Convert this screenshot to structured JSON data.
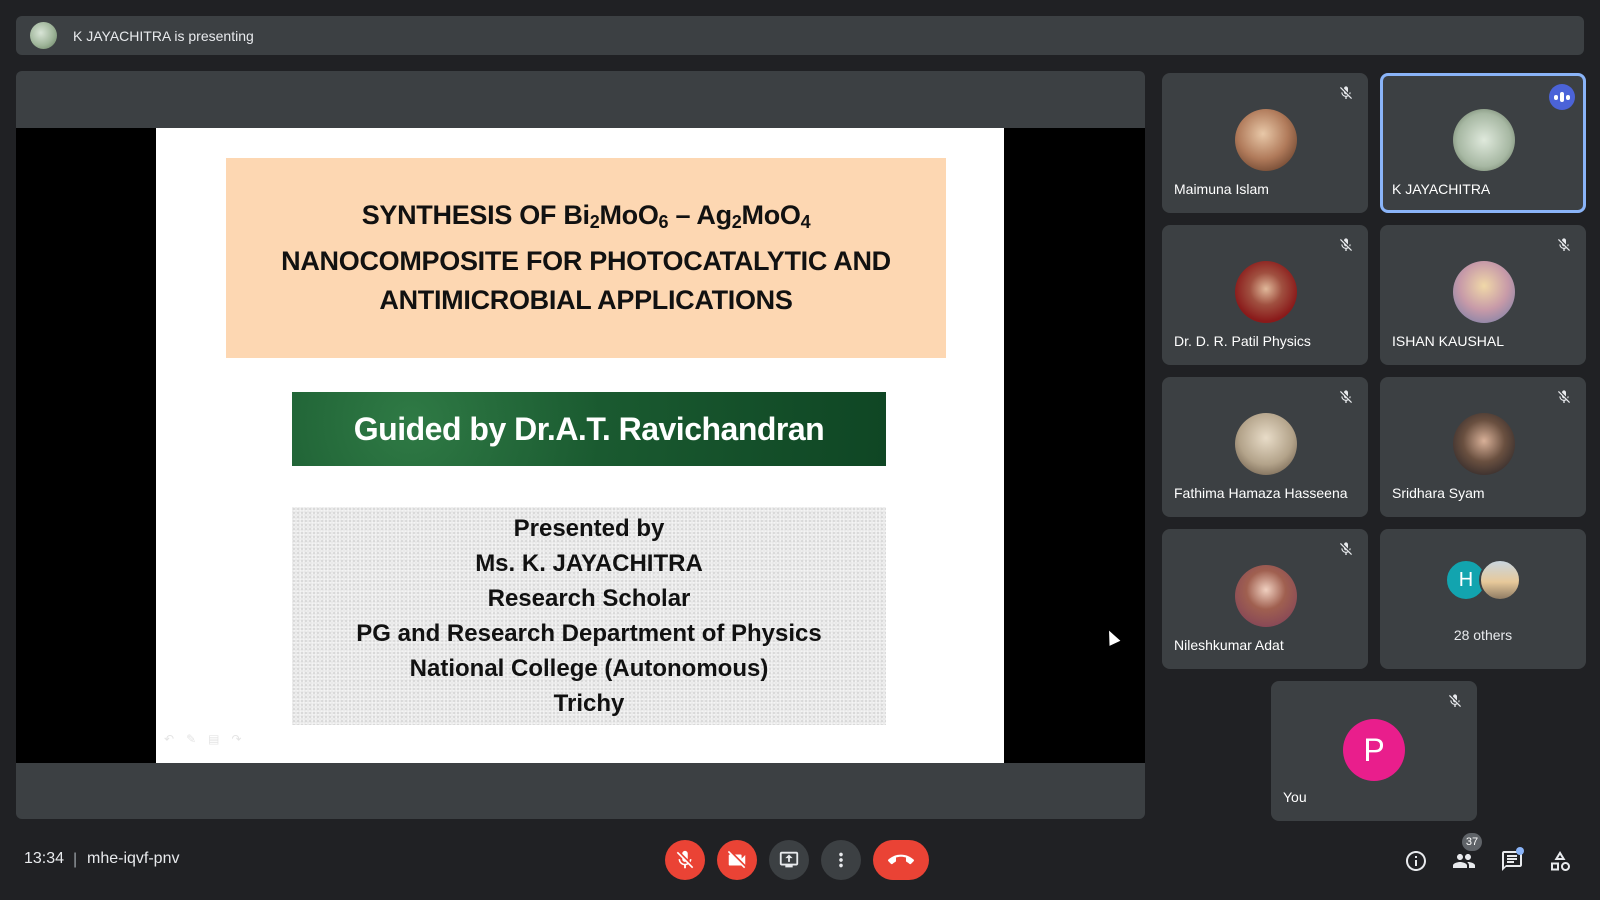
{
  "banner": {
    "text": "K JAYACHITRA is presenting"
  },
  "slide": {
    "title_line1_a": "SYNTHESIS OF Bi",
    "title_line1_sub1": "2",
    "title_line1_b": "MoO",
    "title_line1_sub2": "6",
    "title_line1_c": " – Ag",
    "title_line1_sub3": "2",
    "title_line1_d": "MoO",
    "title_line1_sub4": "4",
    "title_line2": "NANOCOMPOSITE FOR PHOTOCATALYTIC AND",
    "title_line3": "ANTIMICROBIAL  APPLICATIONS",
    "guided": "Guided by  Dr.A.T. Ravichandran",
    "presented": [
      "Presented by",
      "Ms. K. JAYACHITRA",
      "Research Scholar",
      "PG and Research Department of Physics",
      "National College (Autonomous)",
      "Trichy"
    ]
  },
  "participants": [
    {
      "name": "Maimuna Islam",
      "muted": true,
      "avatar_color": "#b07a5a"
    },
    {
      "name": "K JAYACHITRA",
      "muted": false,
      "speaking": true,
      "avatar_color": "#a7b8a3"
    },
    {
      "name": "Dr. D. R. Patil Physics",
      "muted": true,
      "avatar_color": "#8a1a1a"
    },
    {
      "name": "ISHAN KAUSHAL",
      "muted": true,
      "avatar_color": "#c79aa8"
    },
    {
      "name": "Fathima Hamaza Hasseena",
      "muted": true,
      "avatar_color": "#b3a38a"
    },
    {
      "name": "Sridhara Syam",
      "muted": true,
      "avatar_color": "#2d3748"
    },
    {
      "name": "Nileshkumar Adat",
      "muted": true,
      "avatar_color": "#7a4a3a"
    }
  ],
  "others": {
    "initial": "H",
    "label": "28 others"
  },
  "self": {
    "initial": "P",
    "label": "You",
    "muted": true
  },
  "bottom": {
    "time": "13:34",
    "separator": "|",
    "meeting_code": "mhe-iqvf-pnv",
    "people_count": "37"
  },
  "icons": {
    "mic": "mic-off-icon",
    "camera": "videocam-off-icon",
    "present": "present-screen-icon",
    "more": "more-vert-icon",
    "hangup": "call-end-icon",
    "info": "info-icon",
    "people": "people-icon",
    "chat": "chat-icon",
    "activities": "activities-icon"
  },
  "colors": {
    "accent": "#8ab4f8",
    "danger": "#ea4335",
    "surface": "#3c4043",
    "background": "#202124"
  }
}
